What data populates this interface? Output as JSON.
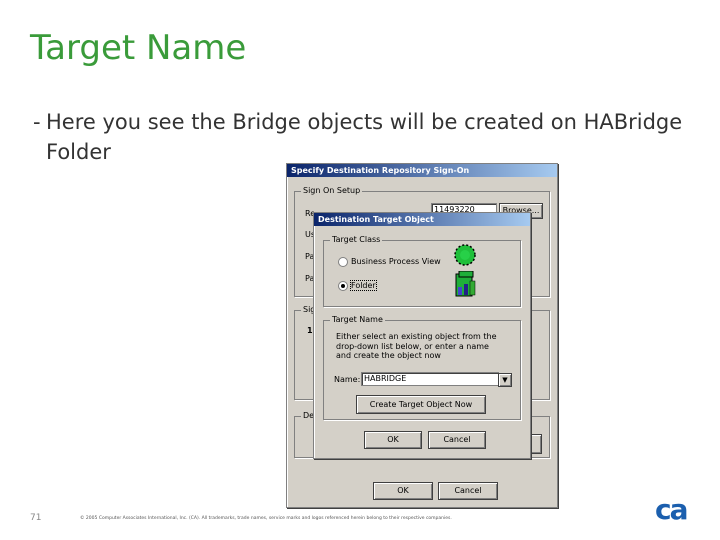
{
  "slide": {
    "title": "Target Name",
    "bullet_dash": "-",
    "bullet_text": "Here you see the Bridge objects will be created on HABridge Folder",
    "page_number": "71",
    "copyright": "© 2005 Computer Associates International, Inc. (CA). All trademarks, trade names, service marks and logos referenced herein belong to their respective companies.",
    "logo_text": "ca"
  },
  "back_dialog": {
    "title": "Specify Destination Repository Sign-On",
    "group_signon": "Sign On Setup",
    "label_r": "Re",
    "label_u": "Us",
    "label_p1": "Pa",
    "label_p2": "Pa",
    "repository_value": "11493220",
    "browse_label": "Browse...",
    "group_sig": "Sig",
    "label_1": "1",
    "group_de": "De",
    "ok_label": "OK",
    "cancel_label": "Cancel"
  },
  "front_dialog": {
    "title": "Destination Target Object",
    "group_target_class": "Target Class",
    "option_bpv": "Business Process View",
    "option_folder": "Folder",
    "group_target_name": "Target Name",
    "instructions": "Either select an existing object from the drop-down list below, or enter a name and create the object now",
    "name_label": "Name:",
    "name_value": "HABRIDGE",
    "create_button": "Create Target Object Now",
    "ok_label": "OK",
    "cancel_label": "Cancel"
  }
}
